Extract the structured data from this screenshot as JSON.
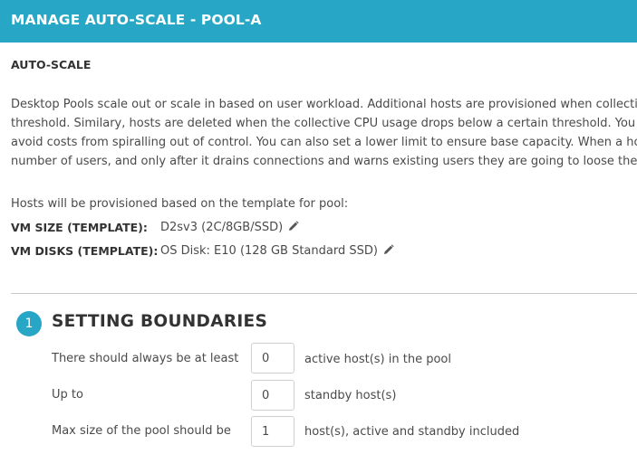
{
  "header": {
    "title": "MANAGE AUTO-SCALE - POOL-A"
  },
  "section": {
    "title": "AUTO-SCALE"
  },
  "description": {
    "lines": [
      "Desktop Pools scale out or scale in based on user workload. Additional hosts are provisioned when collective",
      "threshold. Similary, hosts are deleted when the collective CPU usage drops below a certain threshold. You",
      "avoid costs from spiralling out of control. You can also set a lower limit to ensure base capacity. When a ho",
      "number of users, and only after it drains connections and warns existing users they are going to loose their"
    ]
  },
  "template": {
    "intro": "Hosts will be provisioned based on the template for pool:",
    "vm_size": {
      "label": "VM SIZE (TEMPLATE):",
      "value": "D2sv3 (2C/8GB/SSD)",
      "edit_icon": "pencil-icon"
    },
    "vm_disks": {
      "label": "VM DISKS (TEMPLATE):",
      "value": "OS Disk: E10 (128 GB Standard SSD)",
      "edit_icon": "pencil-icon"
    }
  },
  "step1": {
    "number": "1",
    "title": "SETTING BOUNDARIES",
    "fields": [
      {
        "label": "There should always be at least",
        "value": "0",
        "suffix": "active host(s) in the pool"
      },
      {
        "label": "Up to",
        "value": "0",
        "suffix": "standby host(s)"
      },
      {
        "label": "Max size of the pool should be",
        "value": "1",
        "suffix": "host(s), active and standby included"
      }
    ]
  },
  "colors": {
    "accent": "#27a7c5",
    "text": "#4a4a4a"
  }
}
